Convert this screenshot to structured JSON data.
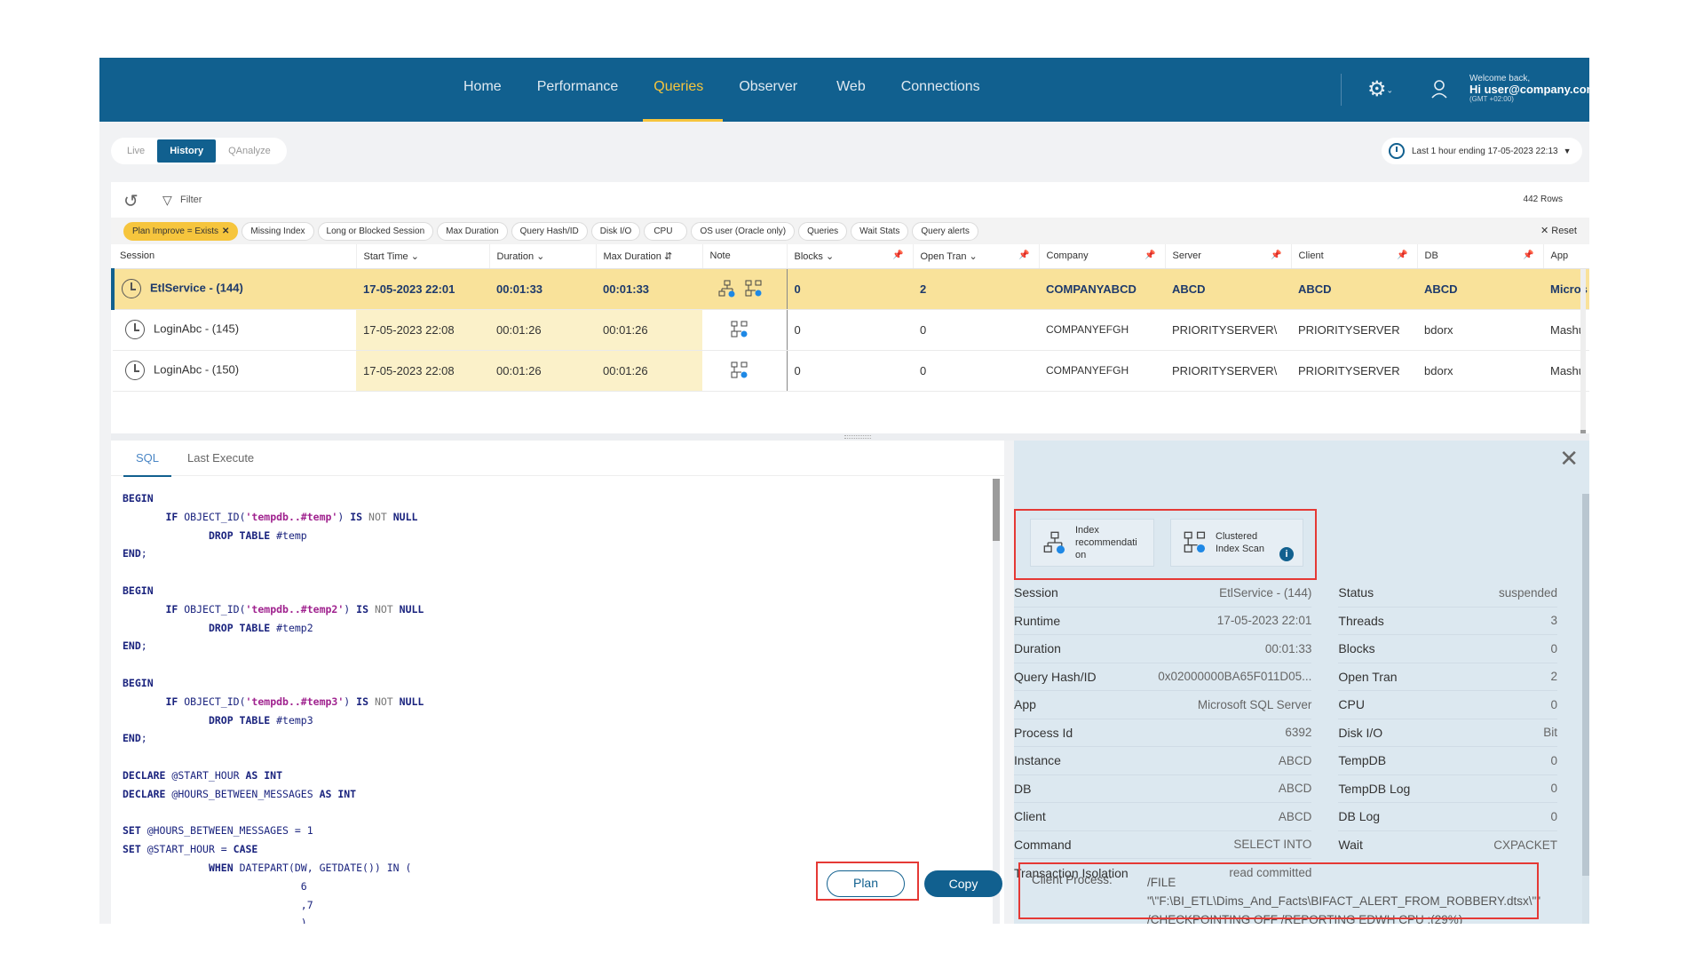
{
  "nav": {
    "items": [
      "Home",
      "Performance",
      "Queries",
      "Observer",
      "Web",
      "Connections"
    ],
    "active": "Queries",
    "welcome": "Welcome back,",
    "user": "Hi user@company.com",
    "tz": "(GMT +02:00)"
  },
  "modes": {
    "items": [
      "Live",
      "History",
      "QAnalyze"
    ],
    "active": "History"
  },
  "time_range": "Last 1 hour ending  17-05-2023 22:13",
  "toolbar": {
    "filter": "Filter",
    "rows": "442 Rows",
    "reset": "Reset"
  },
  "chips": [
    {
      "label": "Plan Improve = Exists",
      "active": true
    },
    {
      "label": "Missing Index"
    },
    {
      "label": "Long or Blocked Session"
    },
    {
      "label": "Max Duration"
    },
    {
      "label": "Query Hash/ID"
    },
    {
      "label": "Disk I/O"
    },
    {
      "label": "CPU"
    },
    {
      "label": "OS user (Oracle only)"
    },
    {
      "label": "Queries"
    },
    {
      "label": "Wait Stats"
    },
    {
      "label": "Query alerts"
    }
  ],
  "grid": {
    "columns": [
      "Session",
      "Start Time",
      "Duration",
      "Max Duration",
      "Note",
      "Blocks",
      "Open Tran",
      "Company",
      "Server",
      "Client",
      "DB",
      "App"
    ],
    "rows": [
      {
        "session": "EtlService - (144)",
        "start": "17-05-2023 22:01",
        "duration": "00:01:33",
        "max": "00:01:33",
        "blocks": "0",
        "open": "2",
        "company": "COMPANYABCD",
        "server": "ABCD",
        "client": "ABCD",
        "db": "ABCD",
        "app": "Micros"
      },
      {
        "session": "LoginAbc - (145)",
        "start": "17-05-2023 22:08",
        "duration": "00:01:26",
        "max": "00:01:26",
        "blocks": "0",
        "open": "0",
        "company": "COMPANYEFGH",
        "server": "PRIORITYSERVER\\",
        "client": "PRIORITYSERVER",
        "db": "bdorx",
        "app": "Mashu"
      },
      {
        "session": "LoginAbc - (150)",
        "start": "17-05-2023 22:08",
        "duration": "00:01:26",
        "max": "00:01:26",
        "blocks": "0",
        "open": "0",
        "company": "COMPANYEFGH",
        "server": "PRIORITYSERVER\\",
        "client": "PRIORITYSERVER",
        "db": "bdorx",
        "app": "Mashu"
      }
    ]
  },
  "sql": {
    "tabs": [
      "SQL",
      "Last Execute"
    ],
    "plan": "Plan",
    "copy": "Copy"
  },
  "details": {
    "alerts": [
      "Index recommendati on",
      "Clustered Index Scan"
    ],
    "left": [
      {
        "k": "Session",
        "v": "EtlService - (144)"
      },
      {
        "k": "Runtime",
        "v": "17-05-2023 22:01"
      },
      {
        "k": "Duration",
        "v": "00:01:33"
      },
      {
        "k": "Query Hash/ID",
        "v": "0x02000000BA65F011D05..."
      },
      {
        "k": "App",
        "v": "Microsoft SQL Server"
      },
      {
        "k": "Process Id",
        "v": "6392"
      },
      {
        "k": "Instance",
        "v": "ABCD"
      },
      {
        "k": "DB",
        "v": "ABCD"
      },
      {
        "k": "Client",
        "v": "ABCD"
      },
      {
        "k": "Command",
        "v": "SELECT INTO"
      },
      {
        "k": "Transaction Isolation",
        "v": "read committed"
      }
    ],
    "right": [
      {
        "k": "Status",
        "v": "suspended"
      },
      {
        "k": "Threads",
        "v": "3"
      },
      {
        "k": "Blocks",
        "v": "0"
      },
      {
        "k": "Open Tran",
        "v": "2"
      },
      {
        "k": "CPU",
        "v": "0"
      },
      {
        "k": "Disk I/O",
        "v": "Bit"
      },
      {
        "k": "TempDB",
        "v": "0"
      },
      {
        "k": "TempDB Log",
        "v": "0"
      },
      {
        "k": "DB Log",
        "v": "0"
      },
      {
        "k": "Wait",
        "v": "CXPACKET"
      }
    ],
    "client_label": "Client Process:",
    "client_value": "/FILE \"\\\"F:\\BI_ETL\\Dims_And_Facts\\BIFACT_ALERT_FROM_ROBBERY.dtsx\\\"\" /CHECKPOINTING OFF /REPORTING EDWH CPU :(29%)"
  }
}
